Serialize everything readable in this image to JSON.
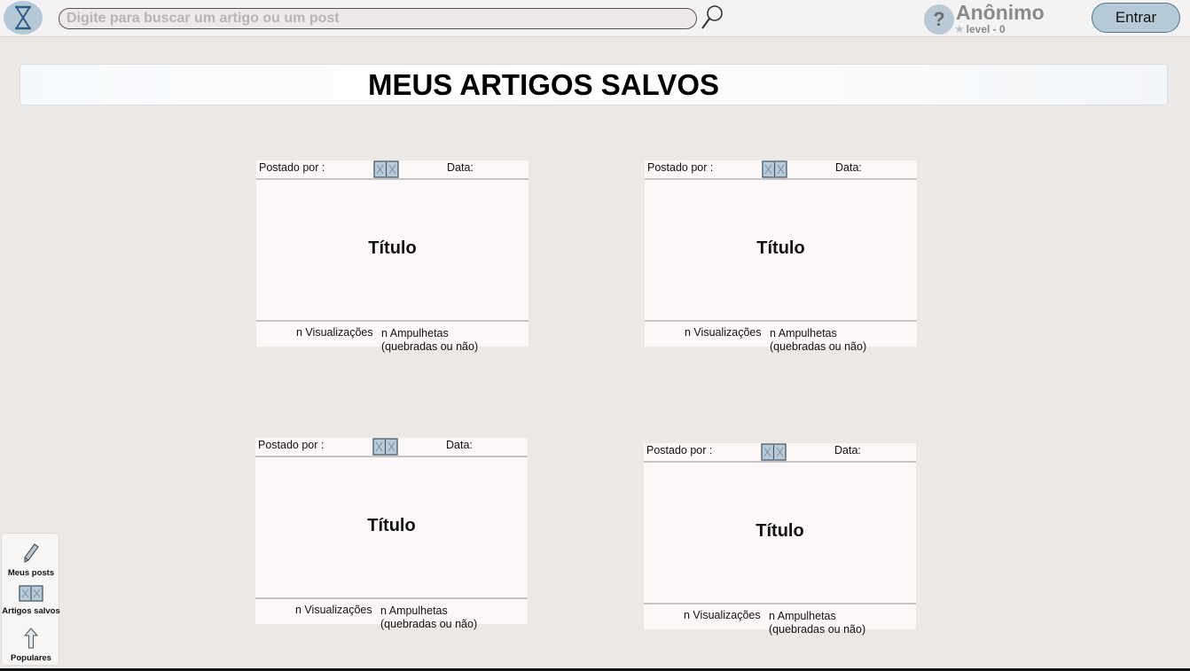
{
  "header": {
    "search_placeholder": "Digite para buscar um artigo ou um post",
    "help_label": "?",
    "user_name": "Anônimo",
    "user_level": "level - 0",
    "login_label": "Entrar"
  },
  "page": {
    "title": "MEUS ARTIGOS SALVOS"
  },
  "cards": [
    {
      "author_label": "Postado por :",
      "date_label": "Data:",
      "title": "Título",
      "views": "n Visualizações",
      "hourglasses_line1": "n Ampulhetas",
      "hourglasses_line2": "(quebradas ou não)"
    },
    {
      "author_label": "Postado por :",
      "date_label": "Data:",
      "title": "Título",
      "views": "n Visualizações",
      "hourglasses_line1": "n Ampulhetas",
      "hourglasses_line2": "(quebradas ou não)"
    },
    {
      "author_label": "Postado por :",
      "date_label": "Data:",
      "title": "Título",
      "views": "n Visualizações",
      "hourglasses_line1": "n Ampulhetas",
      "hourglasses_line2": "(quebradas ou não)"
    },
    {
      "author_label": "Postado por :",
      "date_label": "Data:",
      "title": "Título",
      "views": "n Visualizações",
      "hourglasses_line1": "n Ampulhetas",
      "hourglasses_line2": "(quebradas ou não)"
    }
  ],
  "sidenav": {
    "items": [
      {
        "label": "Meus posts",
        "icon": "pencil-icon"
      },
      {
        "label": "Artigos salvos",
        "icon": "book-icon"
      },
      {
        "label": "Populares",
        "icon": "arrow-up-icon"
      }
    ]
  },
  "colors": {
    "background": "#ece8e6",
    "accent": "#b5c9d6",
    "accent_border": "#4f7592",
    "card": "#fcf8f7"
  }
}
